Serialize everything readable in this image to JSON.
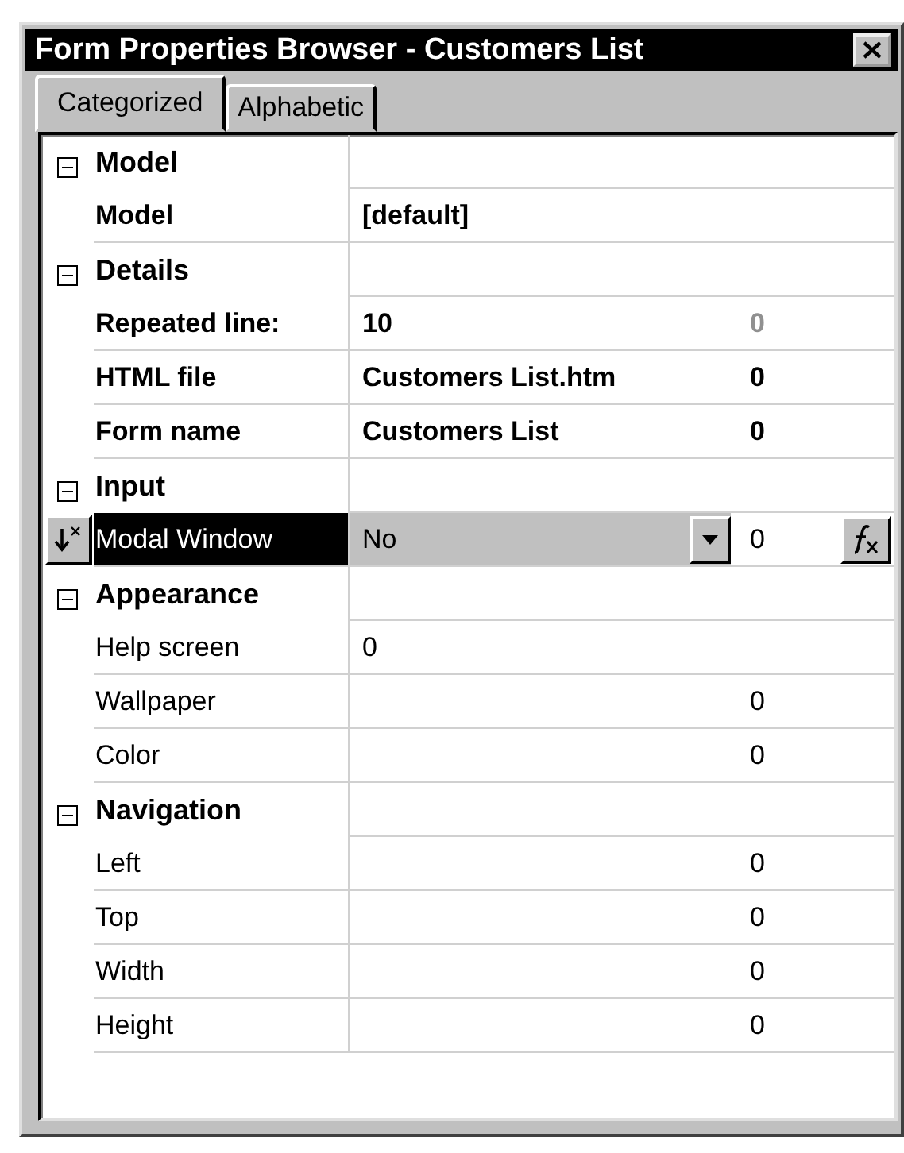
{
  "window": {
    "title": "Form Properties Browser - Customers List"
  },
  "tabs": [
    {
      "label": "Categorized",
      "selected": true
    },
    {
      "label": "Alphabetic",
      "selected": false
    }
  ],
  "categories": [
    {
      "name": "Model",
      "expanded": true,
      "properties": [
        {
          "name": "Model",
          "value": "[default]",
          "modified": true,
          "selected": false,
          "kind": "text"
        }
      ]
    },
    {
      "name": "Details",
      "expanded": true,
      "properties": [
        {
          "name": "Repeated line:",
          "value": "10",
          "column_3": "0",
          "column_3_dimmed": true,
          "modified": true,
          "selected": false,
          "kind": "text"
        },
        {
          "name": "HTML file",
          "value": "Customers List.htm",
          "column_3": "0",
          "column_3_dimmed": false,
          "modified": true,
          "selected": false,
          "kind": "text"
        },
        {
          "name": "Form name",
          "value": "Customers List",
          "column_3": "0",
          "column_3_dimmed": false,
          "modified": true,
          "selected": false,
          "kind": "text"
        }
      ]
    },
    {
      "name": "Input",
      "expanded": true,
      "properties": [
        {
          "name": "Modal Window",
          "value": "No",
          "column_3": "0",
          "column_3_dimmed": false,
          "modified": false,
          "selected": true,
          "kind": "dropdown"
        }
      ]
    },
    {
      "name": "Appearance",
      "expanded": true,
      "properties": [
        {
          "name": "Help screen",
          "value": "0",
          "modified": false,
          "selected": false,
          "kind": "text"
        },
        {
          "name": "Wallpaper",
          "column_3": "0",
          "column_3_dimmed": false,
          "modified": false,
          "selected": false,
          "kind": "text"
        },
        {
          "name": "Color",
          "column_3": "0",
          "column_3_dimmed": false,
          "modified": false,
          "selected": false,
          "kind": "text"
        }
      ]
    },
    {
      "name": "Navigation",
      "expanded": true,
      "properties": [
        {
          "name": "Left",
          "column_3": "0",
          "column_3_dimmed": false,
          "modified": false,
          "selected": false,
          "kind": "text"
        },
        {
          "name": "Top",
          "column_3": "0",
          "column_3_dimmed": false,
          "modified": false,
          "selected": false,
          "kind": "text"
        },
        {
          "name": "Width",
          "column_3": "0",
          "column_3_dimmed": false,
          "modified": false,
          "selected": false,
          "kind": "text"
        },
        {
          "name": "Height",
          "column_3": "0",
          "column_3_dimmed": false,
          "modified": false,
          "selected": false,
          "kind": "text"
        }
      ]
    }
  ]
}
